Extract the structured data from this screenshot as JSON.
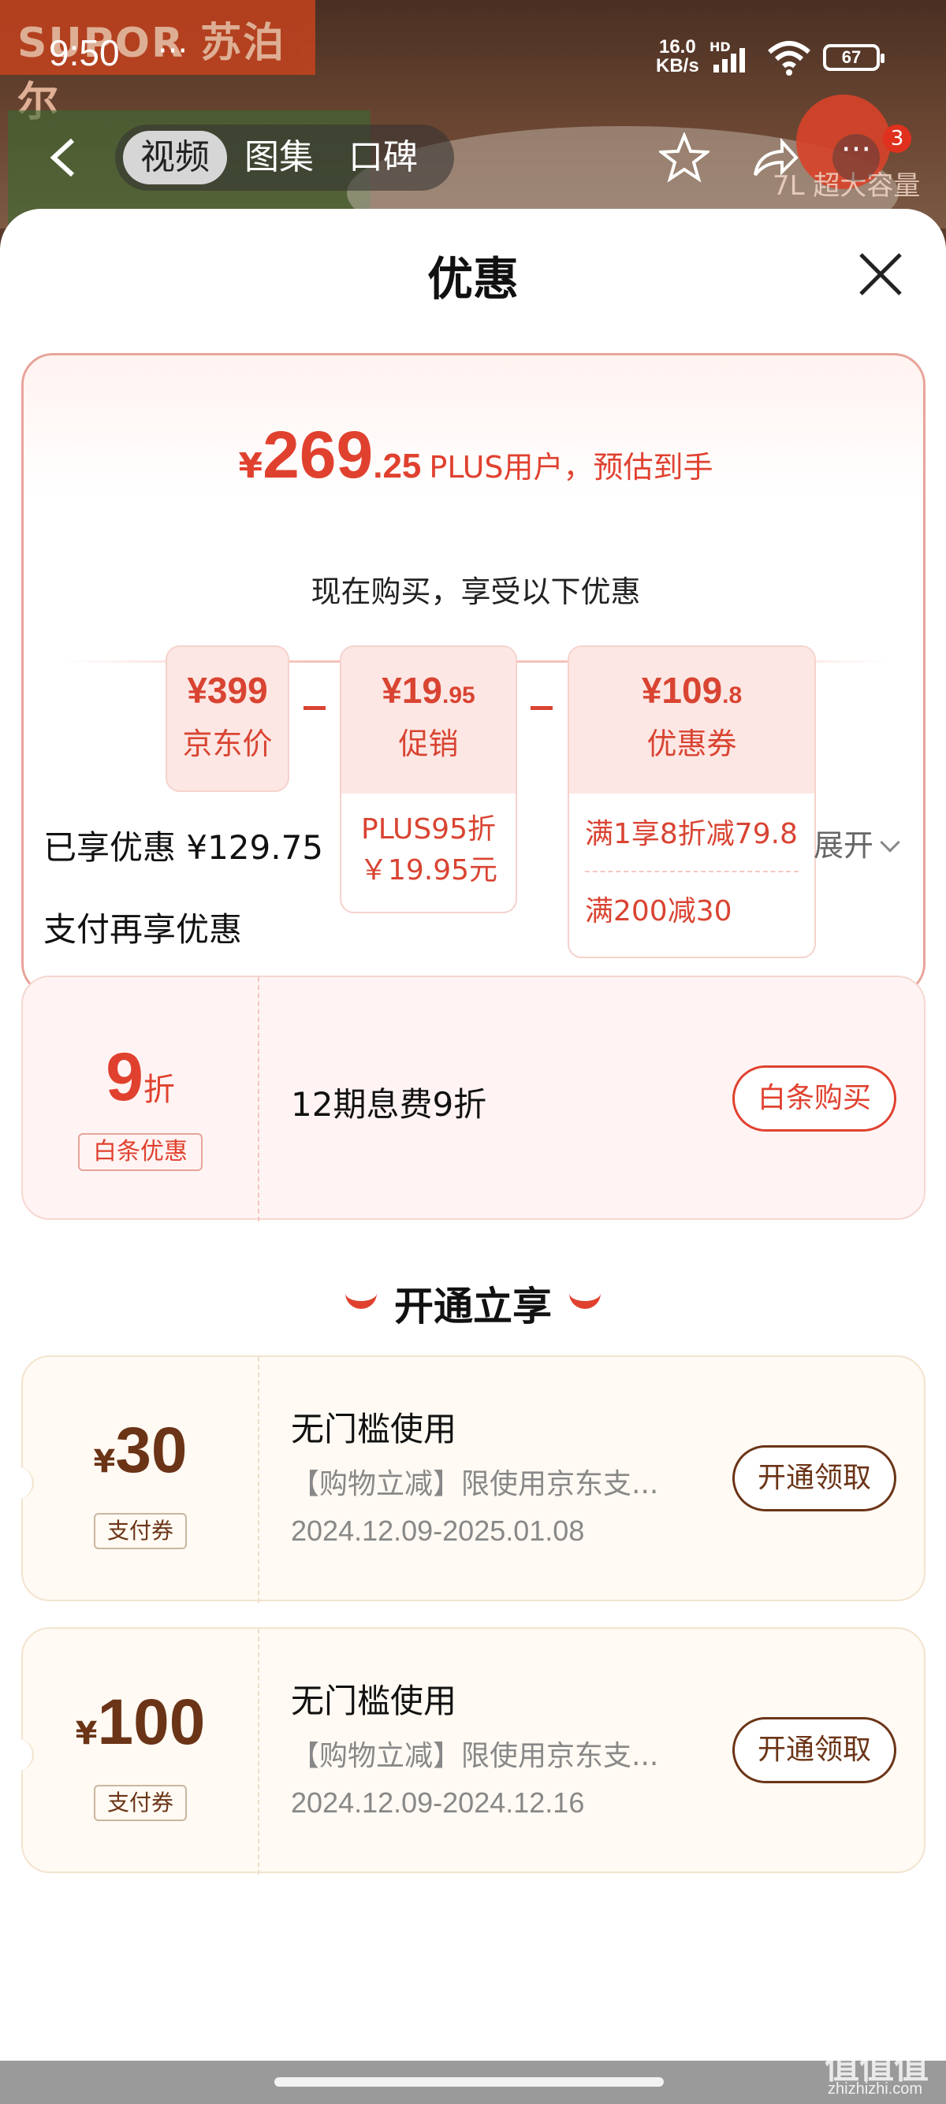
{
  "status": {
    "time": "9:50",
    "net_speed": "16.0",
    "net_unit": "KB/s",
    "hd": "HD",
    "battery": "67",
    "extras": "···"
  },
  "background": {
    "brand": "SUPOR 苏泊尔",
    "caption": "7L 超大容量"
  },
  "header": {
    "tabs": [
      {
        "label": "视频",
        "active": true
      },
      {
        "label": "图集"
      },
      {
        "label": "口碑"
      }
    ],
    "more_badge": "3"
  },
  "sheet": {
    "title": "优惠",
    "estimate": {
      "currency": "¥",
      "integer": "269",
      "decimal": ".25",
      "label": "PLUS用户，预估到手"
    },
    "now_buy": "现在购买，享受以下优惠",
    "breakdown": [
      {
        "currency": "¥",
        "amount": "399",
        "decimal": "",
        "name": "京东价"
      },
      {
        "currency": "¥",
        "amount": "19",
        "decimal": ".95",
        "name": "促销",
        "details": [
          "PLUS95折",
          "￥19.95元"
        ]
      },
      {
        "currency": "¥",
        "amount": "109",
        "decimal": ".8",
        "name": "优惠券",
        "details": [
          "满1享8折减79.8",
          "满200减30"
        ]
      }
    ],
    "enjoyed": "已享优惠 ¥129.75",
    "expand": "展开",
    "pay_more": "支付再享优惠",
    "baitiao": {
      "discount": "9",
      "unit": "折",
      "tag": "白条优惠",
      "text": "12期息费9折",
      "button": "白条购买"
    },
    "open_header": "开通立享",
    "coupons": [
      {
        "currency": "¥",
        "amount": "30",
        "tag": "支付券",
        "title": "无门槛使用",
        "desc": "【购物立减】限使用京东支...",
        "date": "2024.12.09-2025.01.08",
        "button": "开通领取"
      },
      {
        "currency": "¥",
        "amount": "100",
        "tag": "支付券",
        "title": "无门槛使用",
        "desc": "【购物立减】限使用京东支...",
        "date": "2024.12.09-2024.12.16",
        "button": "开通领取"
      }
    ]
  },
  "watermark": {
    "text": "值值值",
    "site": "zhizhizhi.com"
  },
  "colors": {
    "accent": "#e0412f",
    "brown": "#6b3417"
  }
}
